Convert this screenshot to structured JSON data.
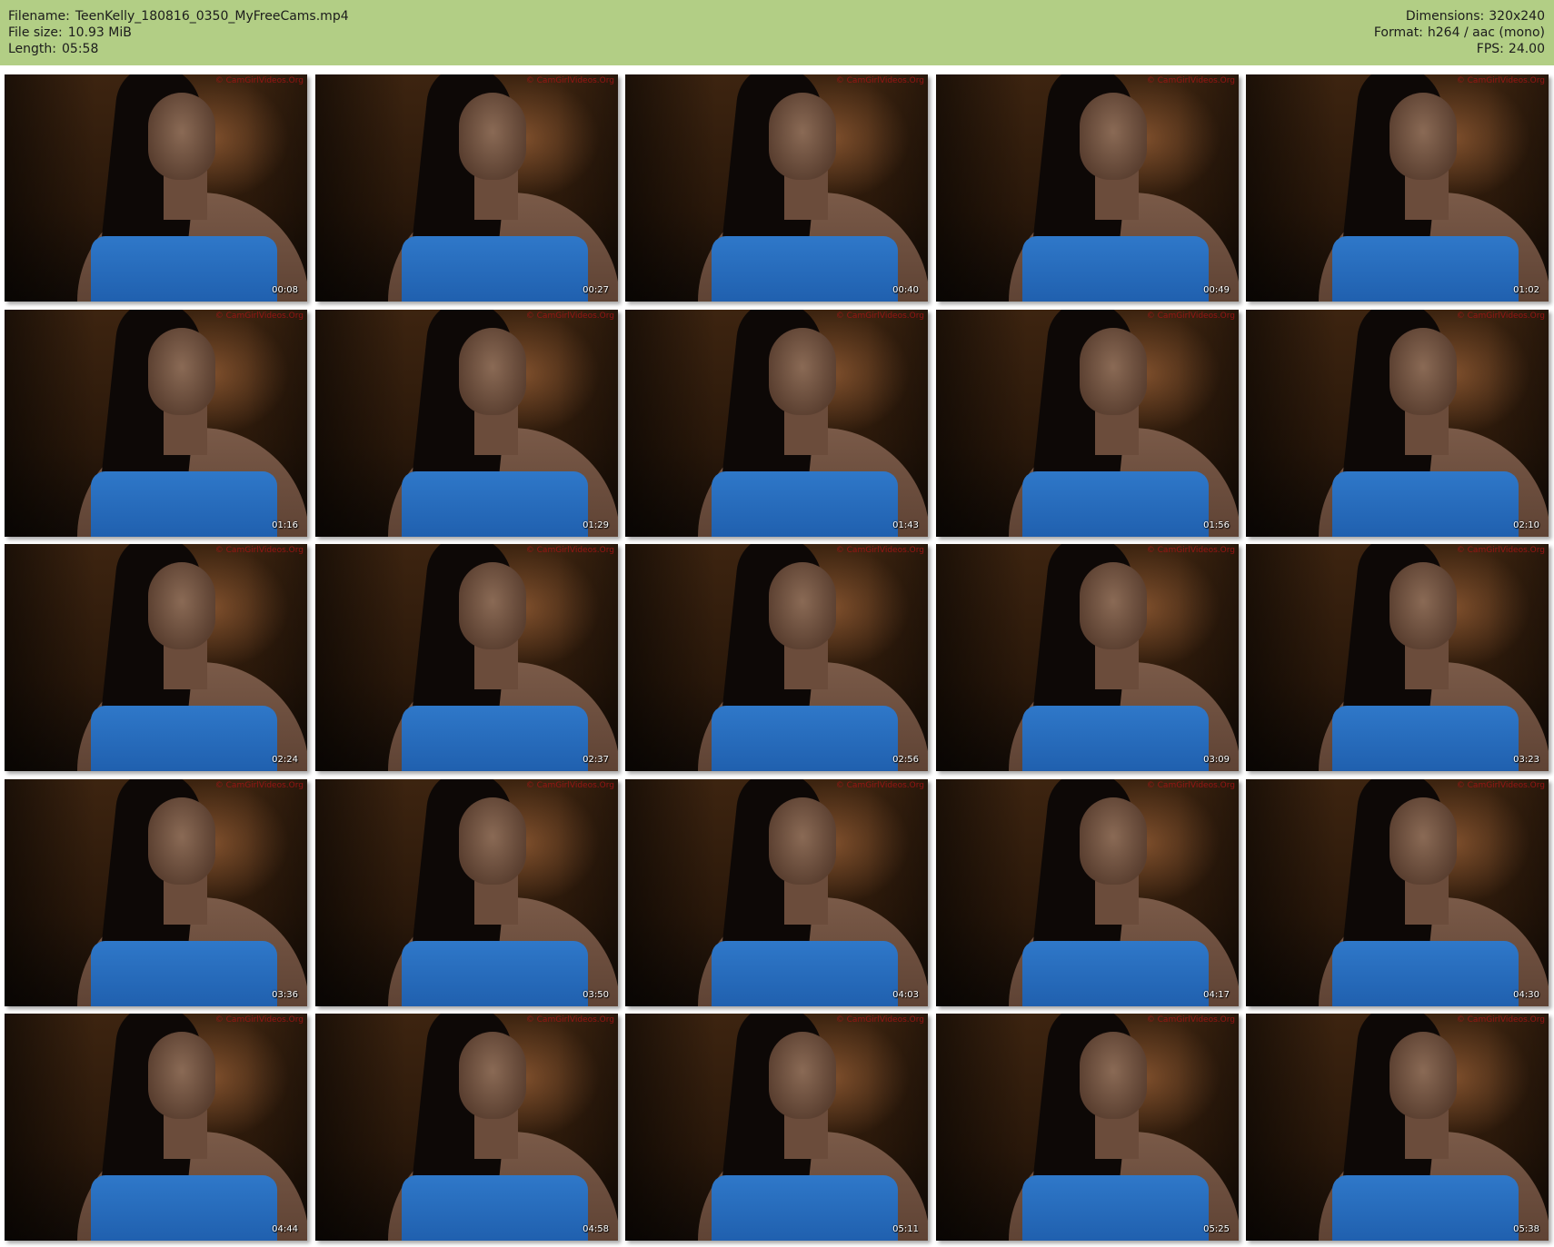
{
  "header": {
    "left": [
      {
        "key": "Filename:",
        "value": "TeenKelly_180816_0350_MyFreeCams.mp4"
      },
      {
        "key": "File size:",
        "value": "10.93 MiB"
      },
      {
        "key": "Length:",
        "value": "05:58"
      }
    ],
    "right": [
      {
        "key": "Dimensions:",
        "value": "320x240"
      },
      {
        "key": "Format:",
        "value": "h264 / aac (mono)"
      },
      {
        "key": "FPS:",
        "value": "24.00"
      }
    ],
    "background_color": "#b2ce85"
  },
  "watermark": "© CamGirlVideos.Org",
  "thumbnails": [
    {
      "timestamp": "00:08"
    },
    {
      "timestamp": "00:27"
    },
    {
      "timestamp": "00:40"
    },
    {
      "timestamp": "00:49"
    },
    {
      "timestamp": "01:02"
    },
    {
      "timestamp": "01:16"
    },
    {
      "timestamp": "01:29"
    },
    {
      "timestamp": "01:43"
    },
    {
      "timestamp": "01:56"
    },
    {
      "timestamp": "02:10"
    },
    {
      "timestamp": "02:24"
    },
    {
      "timestamp": "02:37"
    },
    {
      "timestamp": "02:56"
    },
    {
      "timestamp": "03:09"
    },
    {
      "timestamp": "03:23"
    },
    {
      "timestamp": "03:36"
    },
    {
      "timestamp": "03:50"
    },
    {
      "timestamp": "04:03"
    },
    {
      "timestamp": "04:17"
    },
    {
      "timestamp": "04:30"
    },
    {
      "timestamp": "04:44"
    },
    {
      "timestamp": "04:58"
    },
    {
      "timestamp": "05:11"
    },
    {
      "timestamp": "05:25"
    },
    {
      "timestamp": "05:38"
    }
  ]
}
